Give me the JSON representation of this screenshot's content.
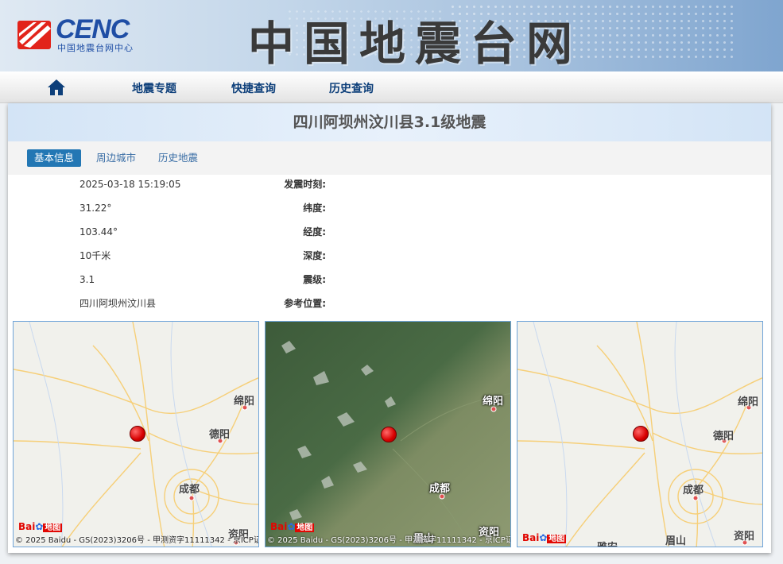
{
  "header": {
    "logo_text": "CENC",
    "logo_sub": "中国地震台网中心",
    "site_title": "中国地震台网"
  },
  "nav": {
    "items": [
      "地震专题",
      "快捷查询",
      "历史查询"
    ]
  },
  "event": {
    "title": "四川阿坝州汶川县3.1级地震"
  },
  "tabs": [
    "基本信息",
    "周边城市",
    "历史地震"
  ],
  "info": [
    {
      "label": "发震时刻:",
      "value": "2025-03-18 15:19:05"
    },
    {
      "label": "纬度:",
      "value": "31.22°"
    },
    {
      "label": "经度:",
      "value": "103.44°"
    },
    {
      "label": "深度:",
      "value": "10千米"
    },
    {
      "label": "震级:",
      "value": "3.1"
    },
    {
      "label": "参考位置:",
      "value": "四川阿坝州汶川县"
    }
  ],
  "maps": {
    "baidu_logo": "Bai",
    "baidu_logo_2": "地图",
    "copyright": "© 2025 Baidu - GS(2023)3206号 - 甲测资字11111342 - 京ICP证",
    "map1": {
      "cities": [
        "绵阳",
        "德阳",
        "成都",
        "资阳"
      ]
    },
    "map2": {
      "cities": [
        "绵阳",
        "成都",
        "资阳",
        "眉山"
      ]
    },
    "map3": {
      "cities": [
        "绵阳",
        "德阳",
        "成都",
        "资阳",
        "眉山",
        "雅安"
      ]
    }
  },
  "colors": {
    "accent": "#2377b4",
    "quake_marker": "#d70000",
    "nav_text": "#0d3f7a"
  }
}
